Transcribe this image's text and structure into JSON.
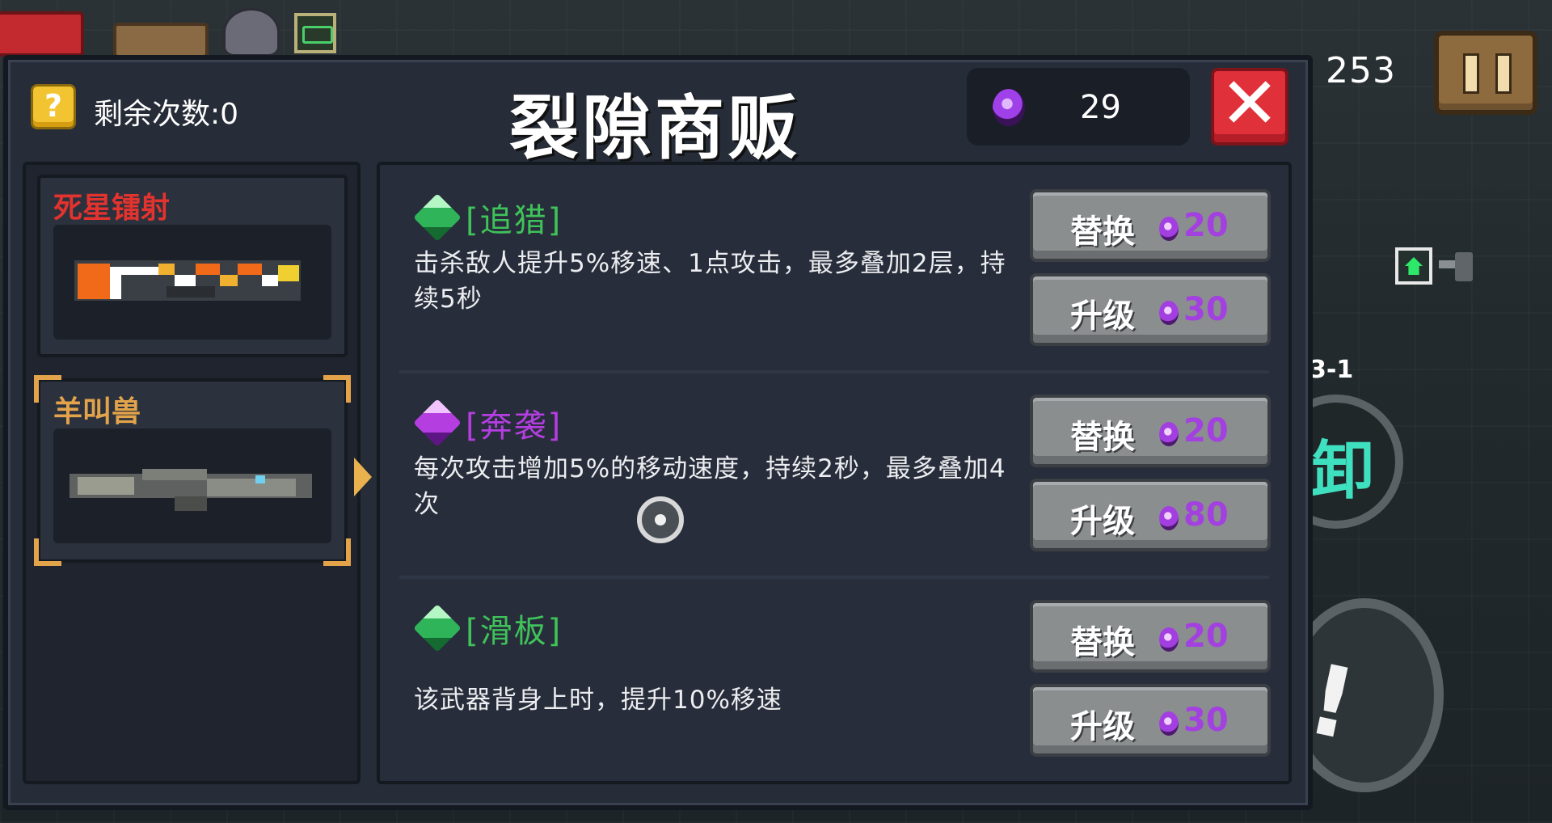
{
  "hud": {
    "score": "253",
    "level": "3-1",
    "skill_glyph": "卸"
  },
  "shop": {
    "title": "裂隙商贩",
    "remaining_label": "剩余次数:0",
    "hint_icon_text": "?",
    "currency_value": "29",
    "close_symbol": "✕"
  },
  "weapons": [
    {
      "name": "死星镭射",
      "color": "#e3332e",
      "selected": false
    },
    {
      "name": "羊叫兽",
      "color": "#e3a34a",
      "selected": true
    }
  ],
  "mods": [
    {
      "name": "[追猎]",
      "gem": "green",
      "name_color": "#3fc25a",
      "description": "击杀敌人提升5%移速、1点攻击，最多叠加2层，持续5秒",
      "replace_label": "替换",
      "replace_cost": "20",
      "upgrade_label": "升级",
      "upgrade_cost": "30"
    },
    {
      "name": "[奔袭]",
      "gem": "purple",
      "name_color": "#b43ee0",
      "description": "每次攻击增加5%的移动速度，持续2秒，最多叠加4次",
      "replace_label": "替换",
      "replace_cost": "20",
      "upgrade_label": "升级",
      "upgrade_cost": "80"
    },
    {
      "name": "[滑板]",
      "gem": "green",
      "name_color": "#3fc25a",
      "description": "该武器背身上时，提升10%移速",
      "replace_label": "替换",
      "replace_cost": "20",
      "upgrade_label": "升级",
      "upgrade_cost": "30"
    }
  ]
}
